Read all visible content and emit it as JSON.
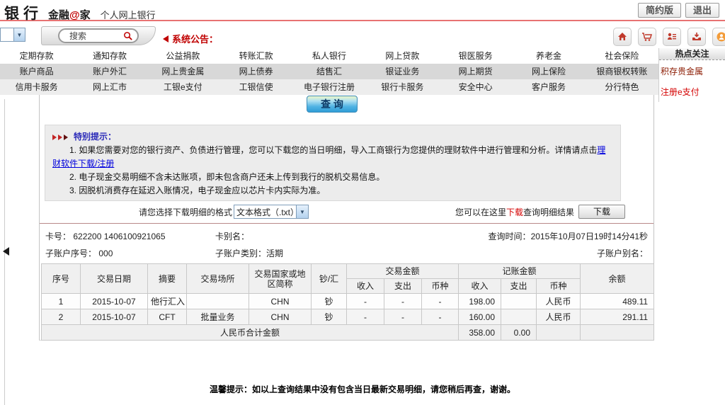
{
  "header": {
    "logo_bank": "银行",
    "brand_pre": "金融",
    "brand_at": "@",
    "brand_post": "家",
    "logo_sub": "个人网上银行",
    "simple_version": "简约版",
    "logout": "退出"
  },
  "toolbar": {
    "search_text": "搜索",
    "announcement": "系统公告："
  },
  "nav": {
    "row1": [
      "定期存款",
      "通知存款",
      "公益捐款",
      "转账汇款",
      "私人银行",
      "网上贷款",
      "银医服务",
      "养老金",
      "社会保险"
    ],
    "row2": [
      "账户商品",
      "账户外汇",
      "网上贵金属",
      "网上债券",
      "结售汇",
      "银证业务",
      "网上期货",
      "网上保险",
      "银商银权转账"
    ],
    "row3": [
      "信用卡服务",
      "网上汇市",
      "工银e支付",
      "工银信使",
      "电子银行注册",
      "银行卡服务",
      "安全中心",
      "客户服务",
      "分行特色"
    ]
  },
  "hot": {
    "title": "热点关注",
    "link1": "积存贵金属",
    "link2": "注册e支付"
  },
  "main": {
    "query_button": "查 询",
    "notice_title": "特别提示：",
    "notice1_pre": "1. 如果您需要对您的银行资产、负债进行管理，您可以下载您的当日明细，导入工商银行为您提供的理财软件中进行管理和分析。详情请点击",
    "notice1_link": "理财软件下载/注册",
    "notice2": "2. 电子现金交易明细不含未达账项，即未包含商户还未上传到我行的脱机交易信息。",
    "notice3": "3. 因脱机消费存在延迟入账情况，电子现金应以芯片卡内实际为准。",
    "download_label": "请您选择下载明细的格式",
    "download_format": "文本格式（.txt）",
    "hint_pre": "您可以在这里",
    "hint_red": "下载",
    "hint_post": "查询明细结果",
    "download_button": "下载"
  },
  "account": {
    "card_no_label": "卡号：",
    "card_no": "622200 1406100921065",
    "card_alias_label": "卡别名：",
    "query_time_label": "查询时间：",
    "query_time": "2015年10月07日19时14分41秒",
    "sub_seq_label": "子账户序号：",
    "sub_seq": "000",
    "sub_type_label": "子账户类别：",
    "sub_type": "活期",
    "sub_alias_label": "子账户别名："
  },
  "table": {
    "h_seq": "序号",
    "h_date": "交易日期",
    "h_summary": "摘要",
    "h_place": "交易场所",
    "h_country": "交易国家或地区简称",
    "h_cash": "钞/汇",
    "h_txn_group": "交易金额",
    "h_book_group": "记账金额",
    "h_income": "收入",
    "h_expense": "支出",
    "h_currency": "币种",
    "h_balance": "余额",
    "rows": [
      {
        "seq": "1",
        "date": "2015-10-07",
        "summary": "他行汇入",
        "place": "",
        "country": "CHN",
        "cash": "钞",
        "t_in": "-",
        "t_out": "-",
        "t_cur": "-",
        "b_in": "198.00",
        "b_out": "",
        "b_cur": "人民币",
        "balance": "489.11"
      },
      {
        "seq": "2",
        "date": "2015-10-07",
        "summary": "CFT",
        "place": "批量业务",
        "country": "CHN",
        "cash": "钞",
        "t_in": "-",
        "t_out": "-",
        "t_cur": "-",
        "b_in": "160.00",
        "b_out": "",
        "b_cur": "人民币",
        "balance": "291.11"
      }
    ],
    "total_label": "人民币合计金额",
    "total_in": "358.00",
    "total_out": "0.00"
  },
  "footer_note": "温馨提示：如以上查询结果中没有包含当日最新交易明细，请您稍后再查，谢谢。"
}
